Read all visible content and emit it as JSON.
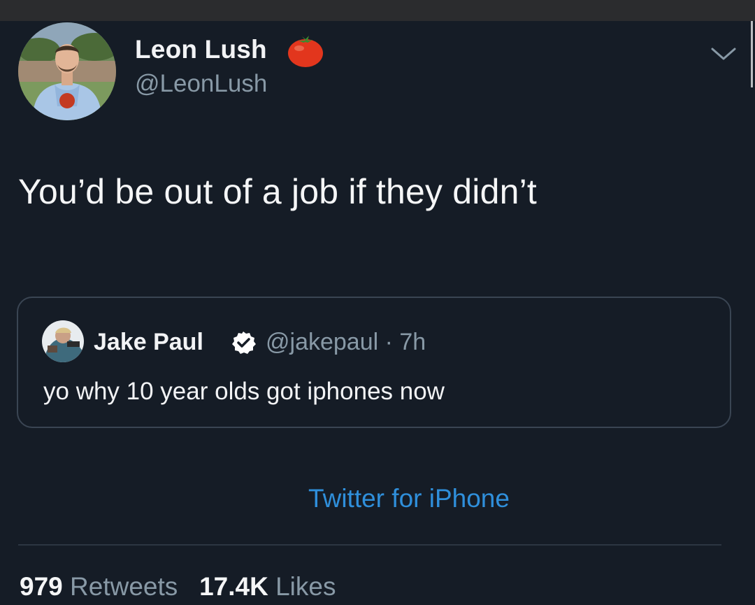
{
  "tweet": {
    "author": {
      "name": "Leon Lush",
      "handle": "@LeonLush",
      "name_badge_icon": "tomato-icon"
    },
    "text": "You’d be out of a job if they didn’t",
    "menu_icon": "chevron-down-icon",
    "quoted": {
      "name": "Jake Paul",
      "verified_icon": "verified-badge-icon",
      "handle_time": "@jakepaul · 7h",
      "text": "yo why 10 year olds got iphones now"
    },
    "source": "Twitter for iPhone",
    "stats": {
      "retweets_count": "979",
      "retweets_label": "Retweets",
      "likes_count": "17.4K",
      "likes_label": "Likes"
    }
  },
  "colors": {
    "background": "#151c26",
    "secondary_text": "#8899a6",
    "link": "#2f8fdb",
    "verified": "#1da1f2",
    "tomato": "#e2361d"
  }
}
